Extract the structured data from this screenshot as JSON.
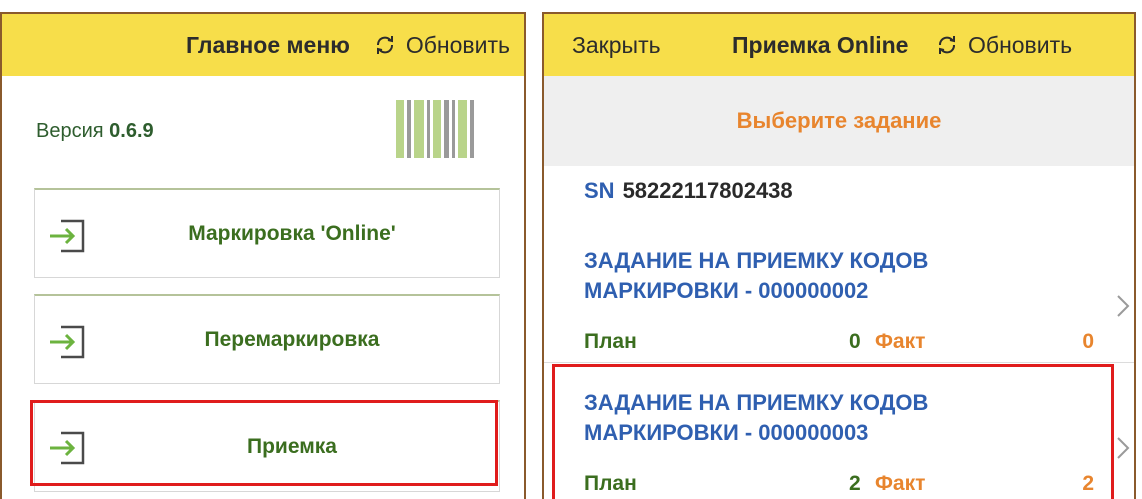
{
  "main_menu": {
    "title": "Главное меню",
    "refresh_label": "Обновить",
    "version_label": "Версия",
    "version_value": "0.6.9",
    "items": [
      {
        "label": "Маркировка 'Online'"
      },
      {
        "label": "Перемаркировка"
      },
      {
        "label": "Приемка"
      }
    ]
  },
  "receiving": {
    "close_label": "Закрыть",
    "title": "Приемка Online",
    "refresh_label": "Обновить",
    "subheader": "Выберите задание",
    "sn_label": "SN",
    "sn_value": "58222117802438",
    "plan_label": "План",
    "fact_label": "Факт",
    "tasks": [
      {
        "name_line1": "ЗАДАНИЕ НА ПРИЕМКУ КОДОВ",
        "name_line2": "МАРКИРОВКИ - 000000002",
        "plan": "0",
        "fact": "0"
      },
      {
        "name_line1": "ЗАДАНИЕ НА ПРИЕМКУ КОДОВ",
        "name_line2": "МАРКИРОВКИ - 000000003",
        "plan": "2",
        "fact": "2"
      }
    ]
  },
  "colors": {
    "topbar": "#f7de4a",
    "accent_green": "#3b6e1f",
    "accent_blue": "#2f5fb0",
    "accent_orange": "#e8852e",
    "highlight_red": "#e01c1c"
  },
  "icons": {
    "refresh": "refresh-icon",
    "login": "login-arrow-icon",
    "barcode": "barcode-icon",
    "chevron": "chevron-right-icon"
  }
}
